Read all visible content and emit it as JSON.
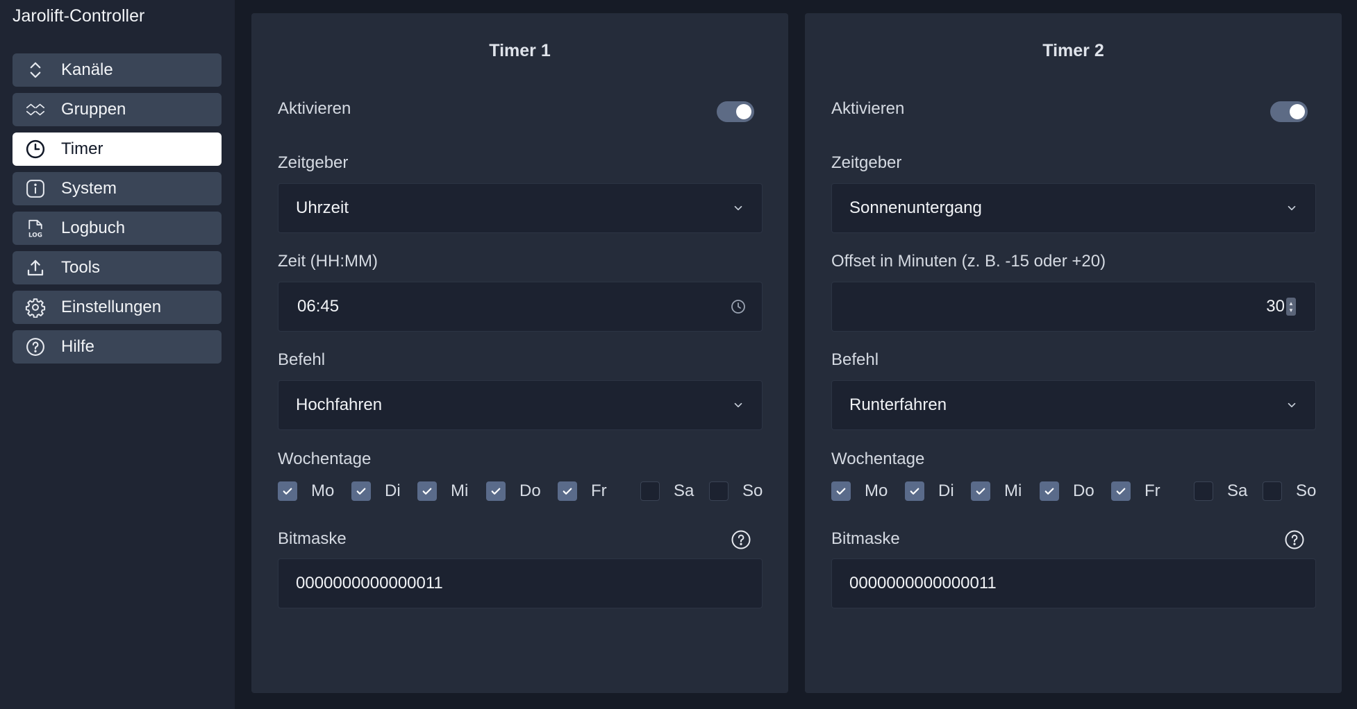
{
  "app": {
    "title": "Jarolift-Controller"
  },
  "sidebar": {
    "items": [
      {
        "label": "Kanäle",
        "icon": "chevron-updown-icon",
        "active": false
      },
      {
        "label": "Gruppen",
        "icon": "double-chevron-icon",
        "active": false
      },
      {
        "label": "Timer",
        "icon": "clock-icon",
        "active": true
      },
      {
        "label": "System",
        "icon": "info-icon",
        "active": false
      },
      {
        "label": "Logbuch",
        "icon": "log-file-icon",
        "active": false
      },
      {
        "label": "Tools",
        "icon": "upload-icon",
        "active": false
      },
      {
        "label": "Einstellungen",
        "icon": "gear-icon",
        "active": false
      },
      {
        "label": "Hilfe",
        "icon": "help-icon",
        "active": false
      }
    ]
  },
  "timers": [
    {
      "title": "Timer 1",
      "enable_label": "Aktivieren",
      "enabled": true,
      "trigger_label": "Zeitgeber",
      "trigger_value": "Uhrzeit",
      "time_label": "Zeit (HH:MM)",
      "time_value": "06:45",
      "command_label": "Befehl",
      "command_value": "Hochfahren",
      "weekdays_label": "Wochentage",
      "days": [
        {
          "label": "Mo",
          "checked": true
        },
        {
          "label": "Di",
          "checked": true
        },
        {
          "label": "Mi",
          "checked": true
        },
        {
          "label": "Do",
          "checked": true
        },
        {
          "label": "Fr",
          "checked": true
        },
        {
          "label": "Sa",
          "checked": false
        },
        {
          "label": "So",
          "checked": false
        }
      ],
      "bitmask_label": "Bitmaske",
      "bitmask_value": "0000000000000011"
    },
    {
      "title": "Timer 2",
      "enable_label": "Aktivieren",
      "enabled": true,
      "trigger_label": "Zeitgeber",
      "trigger_value": "Sonnenuntergang",
      "offset_label": "Offset in Minuten (z. B. -15 oder +20)",
      "offset_value": "30",
      "command_label": "Befehl",
      "command_value": "Runterfahren",
      "weekdays_label": "Wochentage",
      "days": [
        {
          "label": "Mo",
          "checked": true
        },
        {
          "label": "Di",
          "checked": true
        },
        {
          "label": "Mi",
          "checked": true
        },
        {
          "label": "Do",
          "checked": true
        },
        {
          "label": "Fr",
          "checked": true
        },
        {
          "label": "Sa",
          "checked": false
        },
        {
          "label": "So",
          "checked": false
        }
      ],
      "bitmask_label": "Bitmaske",
      "bitmask_value": "0000000000000011"
    }
  ],
  "colors": {
    "page_bg": "#161b26",
    "sidebar_bg": "#1f2533",
    "panel_bg": "#252c3a",
    "nav_item_bg": "#3a4557",
    "accent": "#5a6b8a"
  }
}
